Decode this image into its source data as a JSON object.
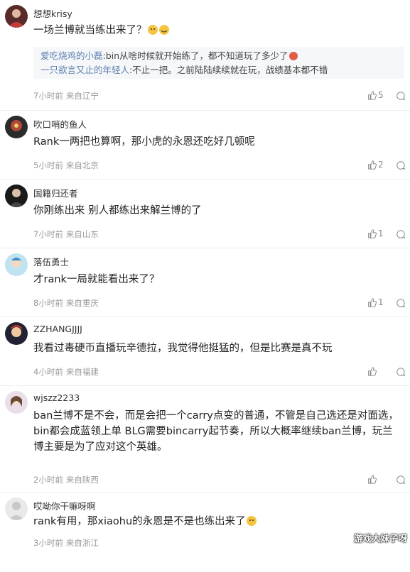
{
  "comments": [
    {
      "username": "想想krisy",
      "text": "一场兰博就当练出来了？",
      "time": "7小时前",
      "location": "来自辽宁",
      "likes": "5",
      "replies": [
        {
          "name": "爱吃烧鸡的小磊",
          "text": ":bin从啥时候就开始练了，都不知道玩了多少了"
        },
        {
          "name": "一只欲言又止的年轻人",
          "text": ":不止一把。之前陆陆续续就在玩，战绩基本都不错"
        }
      ]
    },
    {
      "username": "吹口哨的鱼人",
      "text": "Rank一两把也算啊，那小虎的永恩还吃好几顿呢",
      "time": "5小时前",
      "location": "来自北京",
      "likes": "2"
    },
    {
      "username": "国籍归还者",
      "text": "你刚练出来 别人都练出来解兰博的了",
      "time": "7小时前",
      "location": "来自山东",
      "likes": "1"
    },
    {
      "username": "落伍勇士",
      "text": "才rank一局就能看出来了？",
      "time": "8小时前",
      "location": "来自重庆",
      "likes": "1"
    },
    {
      "username": "ZZHANGJJJJ",
      "text": "我看过毒硬币直播玩辛德拉，我觉得他挺猛的，但是比赛是真不玩",
      "time": "4小时前",
      "location": "来自福建",
      "likes": ""
    },
    {
      "username": "wjszz2233",
      "text": "ban兰博不是不会，而是会把一个carry点变的普通，不管是自己选还是对面选，bin都会成蓝领上单 BLG需要bincarry起节奏，所以大概率继续ban兰博，玩兰博主要是为了应对这个英雄。",
      "time": "2小时前",
      "location": "来自陕西",
      "likes": ""
    },
    {
      "username": "哎呦你干嘛呀啊",
      "text": "rank有用，那xiaohu的永恩是不是也练出来了",
      "time": "3小时前",
      "location": "来自浙江",
      "likes": ""
    }
  ],
  "watermark": "游戏大妹子呀",
  "icons": {
    "like": "thumbs-up-icon",
    "more": "more-comment-icon",
    "emoji": "emoji-face-icon"
  },
  "colors": {
    "reply_name": "#5a7fb0",
    "meta": "#999999",
    "reply_bg": "#f6f7f9"
  }
}
